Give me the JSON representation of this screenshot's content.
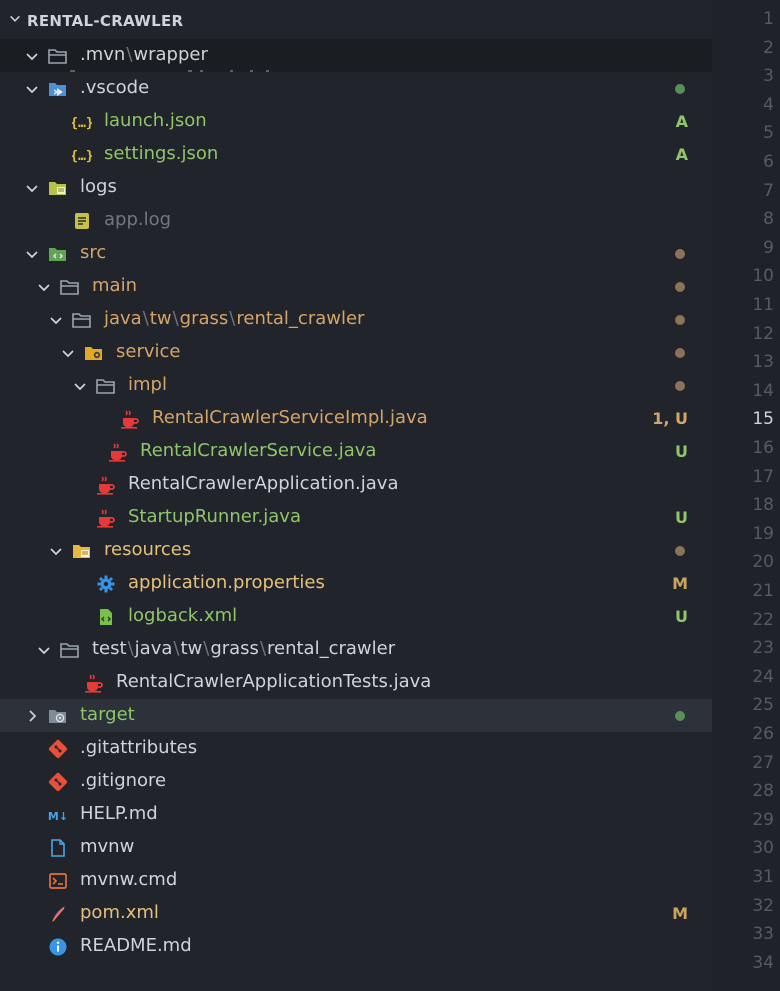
{
  "explorer": {
    "title": "RENTAL-CRAWLER",
    "rows": [
      {
        "label_parts": [
          ".mvn",
          "wrapper"
        ],
        "kind": "folder",
        "indent": 0,
        "twisty": "open",
        "color": "#cfd3da",
        "stuck": true,
        "icon": "folder-open-icon"
      },
      {
        "label_parts": [
          ".vscode"
        ],
        "kind": "folder",
        "indent": 0,
        "twisty": "open",
        "color": "#cfd3da",
        "icon": "folder-vscode-icon",
        "status": "dot",
        "status_color": "#5a8f5a"
      },
      {
        "label_parts": [
          "launch.json"
        ],
        "kind": "file",
        "indent": 1,
        "color": "#8fc56b",
        "icon": "json-icon",
        "badge": "A",
        "badge_color": "#8fc56b"
      },
      {
        "label_parts": [
          "settings.json"
        ],
        "kind": "file",
        "indent": 1,
        "color": "#8fc56b",
        "icon": "json-icon",
        "badge": "A",
        "badge_color": "#8fc56b"
      },
      {
        "label_parts": [
          "logs"
        ],
        "kind": "folder",
        "indent": 0,
        "twisty": "open",
        "color": "#cfd3da",
        "icon": "folder-logs-icon"
      },
      {
        "label_parts": [
          "app.log"
        ],
        "kind": "file",
        "indent": 1,
        "color": "#717781",
        "icon": "log-file-icon"
      },
      {
        "label_parts": [
          "src"
        ],
        "kind": "folder",
        "indent": 0,
        "twisty": "open",
        "color": "#d4a56a",
        "icon": "folder-src-icon",
        "status": "dot",
        "status_color": "#8a7358"
      },
      {
        "label_parts": [
          "main"
        ],
        "kind": "folder",
        "indent": 1,
        "twisty": "open",
        "color": "#d4a56a",
        "icon": "folder-open-icon",
        "status": "dot",
        "status_color": "#8a7358"
      },
      {
        "label_parts": [
          "java",
          "tw",
          "grass",
          "rental_crawler"
        ],
        "kind": "folder",
        "indent": 2,
        "twisty": "open",
        "color": "#d4a56a",
        "icon": "folder-open-icon",
        "status": "dot",
        "status_color": "#8a7358"
      },
      {
        "label_parts": [
          "service"
        ],
        "kind": "folder",
        "indent": 3,
        "twisty": "open",
        "color": "#d4a56a",
        "icon": "folder-service-icon",
        "status": "dot",
        "status_color": "#8a7358"
      },
      {
        "label_parts": [
          "impl"
        ],
        "kind": "folder",
        "indent": 4,
        "twisty": "open",
        "color": "#d4a56a",
        "icon": "folder-open-icon",
        "status": "dot",
        "status_color": "#8a7358"
      },
      {
        "label_parts": [
          "RentalCrawlerServiceImpl.java"
        ],
        "kind": "file",
        "indent": 5,
        "color": "#d4a56a",
        "icon": "java-icon",
        "badge": "1, U",
        "badge_color": "#d4a56a"
      },
      {
        "label_parts": [
          "RentalCrawlerService.java"
        ],
        "kind": "file",
        "indent": 4,
        "color": "#8fc56b",
        "icon": "java-icon",
        "badge": "U",
        "badge_color": "#8fc56b"
      },
      {
        "label_parts": [
          "RentalCrawlerApplication.java"
        ],
        "kind": "file",
        "indent": 3,
        "color": "#cfd3da",
        "icon": "java-icon"
      },
      {
        "label_parts": [
          "StartupRunner.java"
        ],
        "kind": "file",
        "indent": 3,
        "color": "#8fc56b",
        "icon": "java-icon",
        "badge": "U",
        "badge_color": "#8fc56b"
      },
      {
        "label_parts": [
          "resources"
        ],
        "kind": "folder",
        "indent": 2,
        "twisty": "open",
        "color": "#e5c07b",
        "icon": "folder-resources-icon",
        "status": "dot",
        "status_color": "#8a7358"
      },
      {
        "label_parts": [
          "application.properties"
        ],
        "kind": "file",
        "indent": 3,
        "color": "#e5c07b",
        "icon": "gear-icon",
        "badge": "M",
        "badge_color": "#c9a35f"
      },
      {
        "label_parts": [
          "logback.xml"
        ],
        "kind": "file",
        "indent": 3,
        "color": "#8fc56b",
        "icon": "xml-icon",
        "badge": "U",
        "badge_color": "#8fc56b"
      },
      {
        "label_parts": [
          "test",
          "java",
          "tw",
          "grass",
          "rental_crawler"
        ],
        "kind": "folder",
        "indent": 1,
        "twisty": "open",
        "color": "#cfd3da",
        "icon": "folder-open-icon"
      },
      {
        "label_parts": [
          "RentalCrawlerApplicationTests.java"
        ],
        "kind": "file",
        "indent": 2,
        "color": "#cfd3da",
        "icon": "java-icon"
      },
      {
        "label_parts": [
          "target"
        ],
        "kind": "folder",
        "indent": 0,
        "twisty": "closed",
        "color": "#8fc56b",
        "icon": "folder-target-icon",
        "selected": true,
        "status": "dot",
        "status_color": "#5a8f5a"
      },
      {
        "label_parts": [
          ".gitattributes"
        ],
        "kind": "file",
        "indent": 0,
        "color": "#cfd3da",
        "icon": "git-icon"
      },
      {
        "label_parts": [
          ".gitignore"
        ],
        "kind": "file",
        "indent": 0,
        "color": "#cfd3da",
        "icon": "git-icon"
      },
      {
        "label_parts": [
          "HELP.md"
        ],
        "kind": "file",
        "indent": 0,
        "color": "#cfd3da",
        "icon": "markdown-icon"
      },
      {
        "label_parts": [
          "mvnw"
        ],
        "kind": "file",
        "indent": 0,
        "color": "#cfd3da",
        "icon": "file-icon"
      },
      {
        "label_parts": [
          "mvnw.cmd"
        ],
        "kind": "file",
        "indent": 0,
        "color": "#cfd3da",
        "icon": "terminal-icon"
      },
      {
        "label_parts": [
          "pom.xml"
        ],
        "kind": "file",
        "indent": 0,
        "color": "#e5c07b",
        "icon": "maven-icon",
        "badge": "M",
        "badge_color": "#c9a35f"
      },
      {
        "label_parts": [
          "README.md"
        ],
        "kind": "file",
        "indent": 0,
        "color": "#cfd3da",
        "icon": "info-icon"
      }
    ]
  },
  "gutter": {
    "line_numbers": [
      "1",
      "2",
      "3",
      "4",
      "5",
      "6",
      "7",
      "8",
      "9",
      "10",
      "11",
      "12",
      "13",
      "14",
      "15",
      "16",
      "17",
      "18",
      "19",
      "20",
      "21",
      "22",
      "23",
      "24",
      "25",
      "26",
      "27",
      "28",
      "29",
      "30",
      "31",
      "32",
      "33",
      "34"
    ],
    "active_line": "15"
  }
}
